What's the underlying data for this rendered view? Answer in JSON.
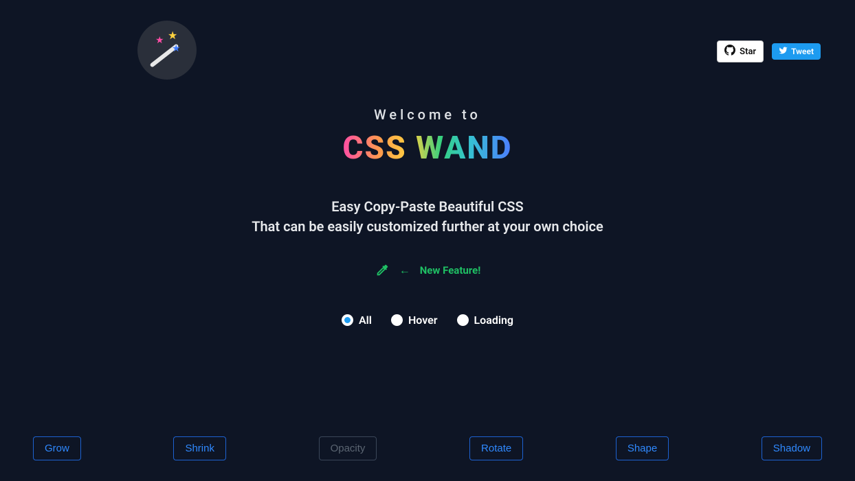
{
  "header": {
    "github_star_label": "Star",
    "tweet_label": "Tweet"
  },
  "hero": {
    "welcome": "Welcome to",
    "brand": "CSS WAND",
    "subtitle_line1": "Easy Copy-Paste Beautiful CSS",
    "subtitle_line2": "That can be easily customized further at your own choice",
    "new_feature_label": "New Feature!"
  },
  "filters": {
    "options": [
      {
        "label": "All",
        "selected": true
      },
      {
        "label": "Hover",
        "selected": false
      },
      {
        "label": "Loading",
        "selected": false
      }
    ]
  },
  "effects": [
    {
      "label": "Grow",
      "dim": false
    },
    {
      "label": "Shrink",
      "dim": false
    },
    {
      "label": "Opacity",
      "dim": true
    },
    {
      "label": "Rotate",
      "dim": false
    },
    {
      "label": "Shape",
      "dim": false
    },
    {
      "label": "Shadow",
      "dim": false
    }
  ]
}
